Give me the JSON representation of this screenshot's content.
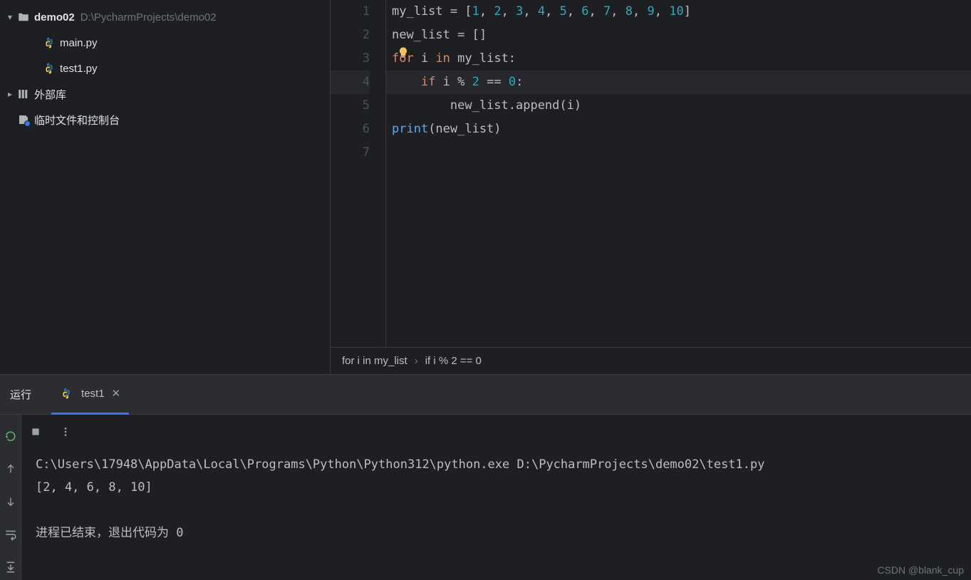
{
  "project_tree": {
    "root_name": "demo02",
    "root_path": "D:\\PycharmProjects\\demo02",
    "files": [
      {
        "name": "main.py"
      },
      {
        "name": "test1.py"
      }
    ],
    "external_libs": "外部库",
    "scratches": "临时文件和控制台"
  },
  "editor": {
    "bulb_line": 3,
    "current_line": 4,
    "code_lines": [
      {
        "tokens": [
          {
            "t": "my_list ",
            "c": "plain"
          },
          {
            "t": "=",
            "c": "op"
          },
          {
            "t": " [",
            "c": "plain"
          },
          {
            "t": "1",
            "c": "num"
          },
          {
            "t": ", ",
            "c": "plain"
          },
          {
            "t": "2",
            "c": "num"
          },
          {
            "t": ", ",
            "c": "plain"
          },
          {
            "t": "3",
            "c": "num"
          },
          {
            "t": ", ",
            "c": "plain"
          },
          {
            "t": "4",
            "c": "num"
          },
          {
            "t": ", ",
            "c": "plain"
          },
          {
            "t": "5",
            "c": "num"
          },
          {
            "t": ", ",
            "c": "plain"
          },
          {
            "t": "6",
            "c": "num"
          },
          {
            "t": ", ",
            "c": "plain"
          },
          {
            "t": "7",
            "c": "num"
          },
          {
            "t": ", ",
            "c": "plain"
          },
          {
            "t": "8",
            "c": "num"
          },
          {
            "t": ", ",
            "c": "plain"
          },
          {
            "t": "9",
            "c": "num"
          },
          {
            "t": ", ",
            "c": "plain"
          },
          {
            "t": "10",
            "c": "num"
          },
          {
            "t": "]",
            "c": "plain"
          }
        ]
      },
      {
        "tokens": [
          {
            "t": "new_list ",
            "c": "plain"
          },
          {
            "t": "=",
            "c": "op"
          },
          {
            "t": " []",
            "c": "plain"
          }
        ]
      },
      {
        "tokens": [
          {
            "t": "for ",
            "c": "kw"
          },
          {
            "t": "i ",
            "c": "plain"
          },
          {
            "t": "in ",
            "c": "kw"
          },
          {
            "t": "my_list:",
            "c": "plain"
          }
        ]
      },
      {
        "tokens": [
          {
            "t": "    ",
            "c": "plain"
          },
          {
            "t": "if ",
            "c": "kw"
          },
          {
            "t": "i ",
            "c": "plain"
          },
          {
            "t": "% ",
            "c": "op"
          },
          {
            "t": "2 ",
            "c": "num"
          },
          {
            "t": "== ",
            "c": "op"
          },
          {
            "t": "0",
            "c": "num"
          },
          {
            "t": ":",
            "c": "plain"
          }
        ]
      },
      {
        "tokens": [
          {
            "t": "        new_list.append(i)",
            "c": "plain"
          }
        ]
      },
      {
        "tokens": [
          {
            "t": "print",
            "c": "fn"
          },
          {
            "t": "(new_list)",
            "c": "plain"
          }
        ]
      },
      {
        "tokens": []
      }
    ],
    "breadcrumbs": [
      "for i in my_list",
      "if i % 2 == 0"
    ]
  },
  "run": {
    "tool_label": "运行",
    "tab_name": "test1",
    "output": {
      "command": "C:\\Users\\17948\\AppData\\Local\\Programs\\Python\\Python312\\python.exe D:\\PycharmProjects\\demo02\\test1.py",
      "result": "[2, 4, 6, 8, 10]",
      "exit_text": "进程已结束，退出代码为 ",
      "exit_code": "0"
    }
  },
  "watermark": "CSDN @blank_cup"
}
